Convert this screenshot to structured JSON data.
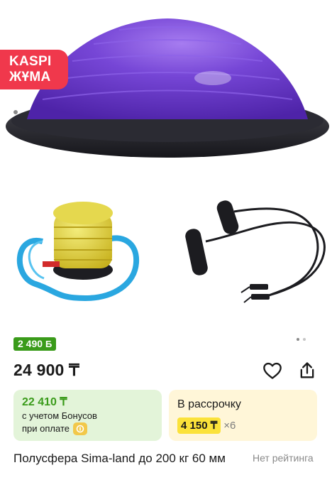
{
  "promo": {
    "line1": "KASPI",
    "line2": "ЖҰМА"
  },
  "gallery": {
    "images": [
      "balance-dome-purple-icon",
      "foot-pump-icon",
      "resistance-bands-icon"
    ],
    "dots_total": 3,
    "dot_active_index": 0
  },
  "price": {
    "bonus_tag": "2 490",
    "bonus_symbol": "Б",
    "main": "24 900 ₸"
  },
  "bonus_card": {
    "price": "22 410 ₸",
    "line1": "с учетом Бонусов",
    "line2": "при оплате"
  },
  "installment_card": {
    "title": "В рассрочку",
    "amount": "4 150 ₸",
    "multiplier": "×6"
  },
  "product": {
    "title": "Полусфера Sima-land до 200 кг 60 мм",
    "rating": "Нет рейтинга"
  },
  "colors": {
    "promo": "#f0384c",
    "bonus_green": "#3a9b1a",
    "installment_yellow": "#fbe23a",
    "dome_purple": "#6a3fc8"
  }
}
